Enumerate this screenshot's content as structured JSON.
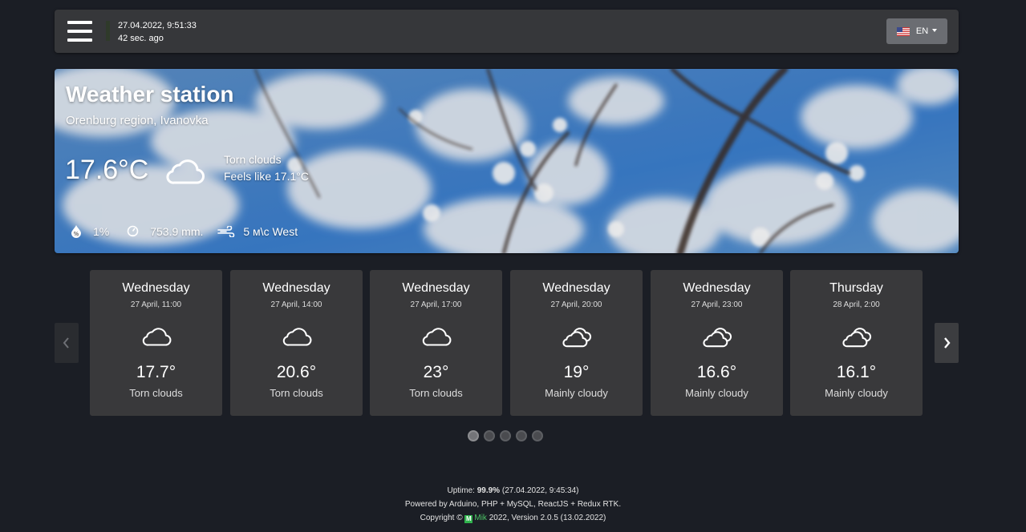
{
  "header": {
    "datetime": "27.04.2022, 9:51:33",
    "ago": "42 sec. ago",
    "language": "EN"
  },
  "hero": {
    "title": "Weather station",
    "location": "Orenburg region, Ivanovka",
    "temperature": "17.6°C",
    "condition": "Torn clouds",
    "feels_like": "Feels like 17.1°C",
    "humidity": "1%",
    "pressure": "753.9 mm.",
    "wind": "5 м\\с West"
  },
  "forecast": [
    {
      "day": "Wednesday",
      "date": "27 April, 11:00",
      "temp": "17.7°",
      "condition": "Torn clouds",
      "icon": "cloud-icon"
    },
    {
      "day": "Wednesday",
      "date": "27 April, 14:00",
      "temp": "20.6°",
      "condition": "Torn clouds",
      "icon": "cloud-icon"
    },
    {
      "day": "Wednesday",
      "date": "27 April, 17:00",
      "temp": "23°",
      "condition": "Torn clouds",
      "icon": "cloud-icon"
    },
    {
      "day": "Wednesday",
      "date": "27 April, 20:00",
      "temp": "19°",
      "condition": "Mainly cloudy",
      "icon": "clouds-icon"
    },
    {
      "day": "Wednesday",
      "date": "27 April, 23:00",
      "temp": "16.6°",
      "condition": "Mainly cloudy",
      "icon": "clouds-icon"
    },
    {
      "day": "Thursday",
      "date": "28 April, 2:00",
      "temp": "16.1°",
      "condition": "Mainly cloudy",
      "icon": "clouds-icon"
    }
  ],
  "pagination": {
    "pages": 5,
    "active": 1
  },
  "footer": {
    "uptime_label": "Uptime:",
    "uptime_value": "99.9%",
    "uptime_since": "(27.04.2022, 9:45:34)",
    "powered": "Powered by Arduino, PHP + MySQL, ReactJS + Redux RTK.",
    "copyright_prefix": "Copyright ©",
    "logo_letter": "M",
    "author": "Mik",
    "copyright_suffix": "2022, Version 2.0.5 (13.02.2022)"
  },
  "colors": {
    "background": "#1b1e25",
    "panel": "#36373a",
    "card": "#39393b",
    "sky": "#3d7ec4",
    "brand_green": "#2fb24c"
  }
}
